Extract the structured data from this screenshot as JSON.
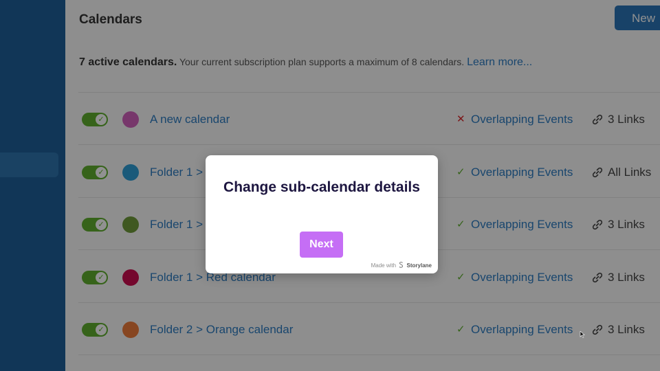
{
  "header": {
    "title": "Calendars",
    "new_button_label": "New"
  },
  "summary": {
    "count_text": "7 active calendars.",
    "plan_text": "Your current subscription plan supports a maximum of 8 calendars.",
    "learn_more": "Learn more..."
  },
  "calendars": [
    {
      "name": "A new calendar",
      "color": "#d162bd",
      "enabled": true,
      "overlap_allowed": false,
      "overlap_label": "Overlapping Events",
      "links": "3 Links"
    },
    {
      "name": "Folder 1 > ",
      "color": "#2f9ed6",
      "enabled": true,
      "overlap_allowed": true,
      "overlap_label": "Overlapping Events",
      "links": "All Links"
    },
    {
      "name": "Folder 1 > ",
      "color": "#6f9b3a",
      "enabled": true,
      "overlap_allowed": true,
      "overlap_label": "Overlapping Events",
      "links": "3 Links"
    },
    {
      "name": "Folder 1 > Red calendar",
      "color": "#cc0e4f",
      "enabled": true,
      "overlap_allowed": true,
      "overlap_label": "Overlapping Events",
      "links": "3 Links"
    },
    {
      "name": "Folder 2 > Orange calendar",
      "color": "#ee7c3a",
      "enabled": true,
      "overlap_allowed": true,
      "overlap_label": "Overlapping Events",
      "links": "3 Links"
    }
  ],
  "icons": {
    "toggle_check": "✓",
    "overlap_no": "✕",
    "overlap_yes": "✓"
  },
  "modal": {
    "title": "Change sub-calendar details",
    "next_label": "Next",
    "made_with": "Made with",
    "brand": "Storylane"
  },
  "colors": {
    "sidebar": "#1e5f99",
    "accent": "#2b75b7",
    "toggle_on": "#5fae2e",
    "modal_button": "#c56ef5"
  }
}
